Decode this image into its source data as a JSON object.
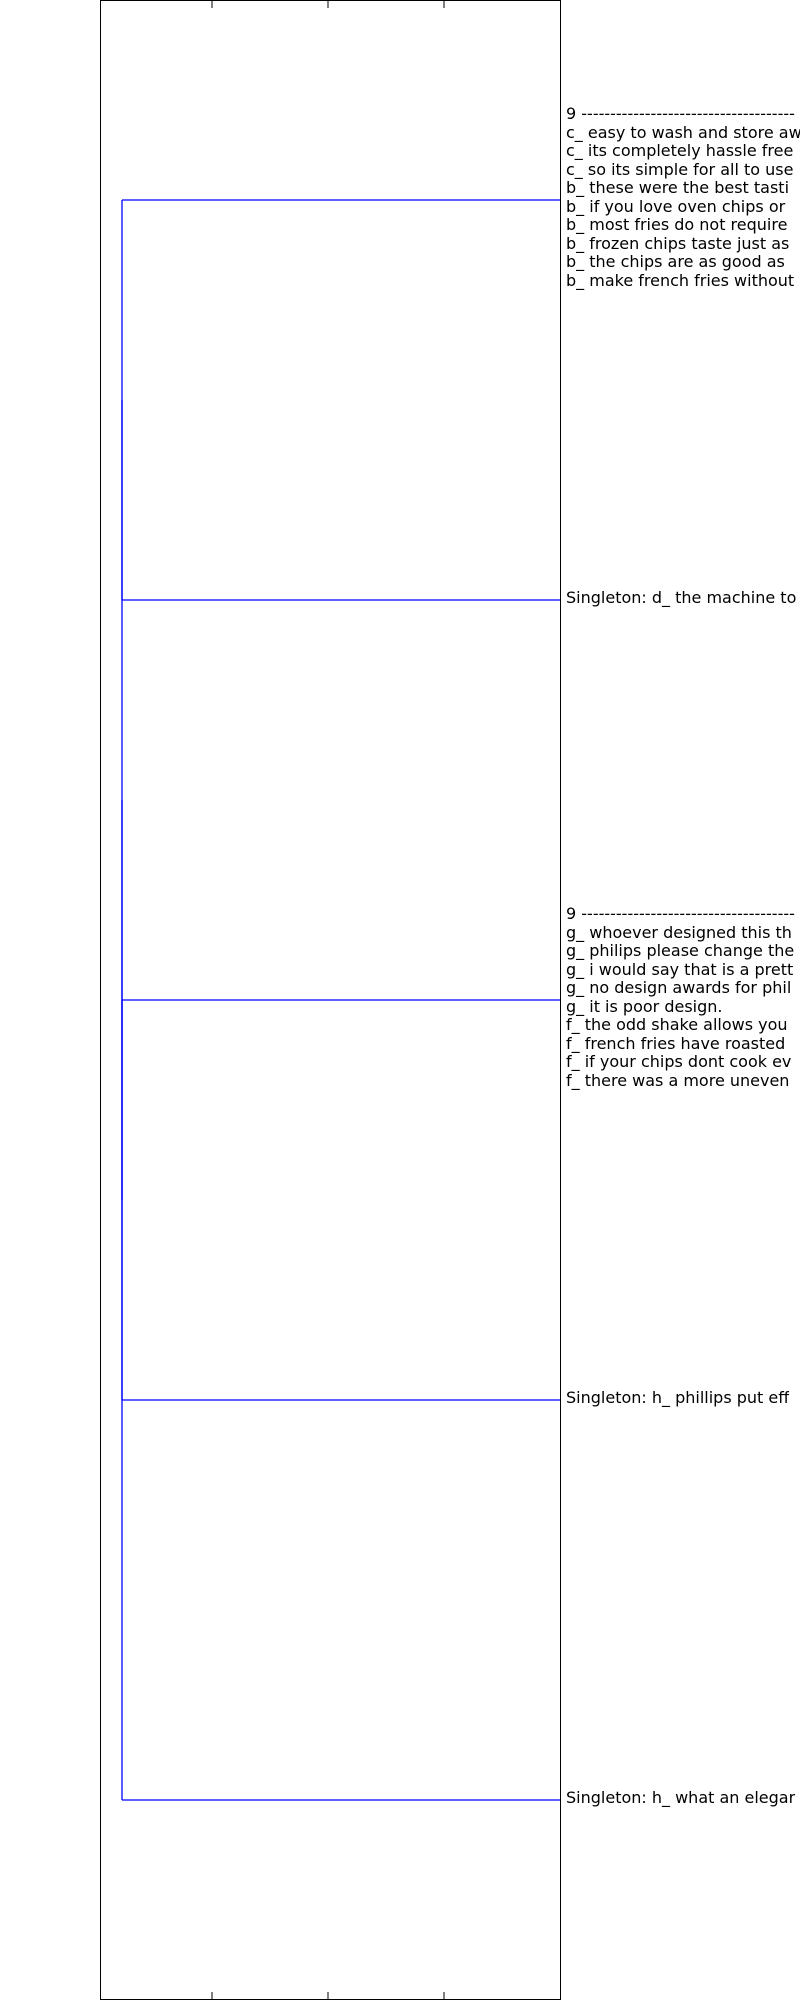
{
  "chart_data": {
    "type": "dendrogram",
    "orientation": "left",
    "link_color": "#0000ff",
    "leaves": [
      {
        "lines": [
          "9 -------------------------------------",
          "c_ easy to wash and store aw",
          "c_ its completely hassle free",
          "c_ so its simple for all to use",
          "b_ these were the best tasti",
          "b_ if you love oven chips or",
          "b_ most fries do not require",
          "b_ frozen chips taste just as",
          "b_ the chips are as good as",
          "b_ make french fries without"
        ]
      },
      {
        "lines": [
          "Singleton: d_ the machine to"
        ]
      },
      {
        "lines": [
          "9 -------------------------------------",
          "g_ whoever designed this th",
          "g_ philips please change the",
          "g_ i would say that is a prett",
          "g_ no design awards for phil",
          "g_ it is poor design.",
          "f_ the odd shake allows you",
          "f_ french fries have roasted",
          "f_ if your chips dont cook ev",
          "f_ there was a more uneven"
        ]
      },
      {
        "lines": [
          "Singleton: h_ phillips put eff"
        ]
      },
      {
        "lines": [
          "Singleton: h_ what an elegar"
        ]
      }
    ],
    "merges": [
      {
        "a": 0,
        "b": 1
      },
      {
        "a": 2,
        "b": 3
      },
      {
        "a": "m0",
        "b": "m1"
      },
      {
        "a": "m2",
        "b": 4
      }
    ]
  }
}
